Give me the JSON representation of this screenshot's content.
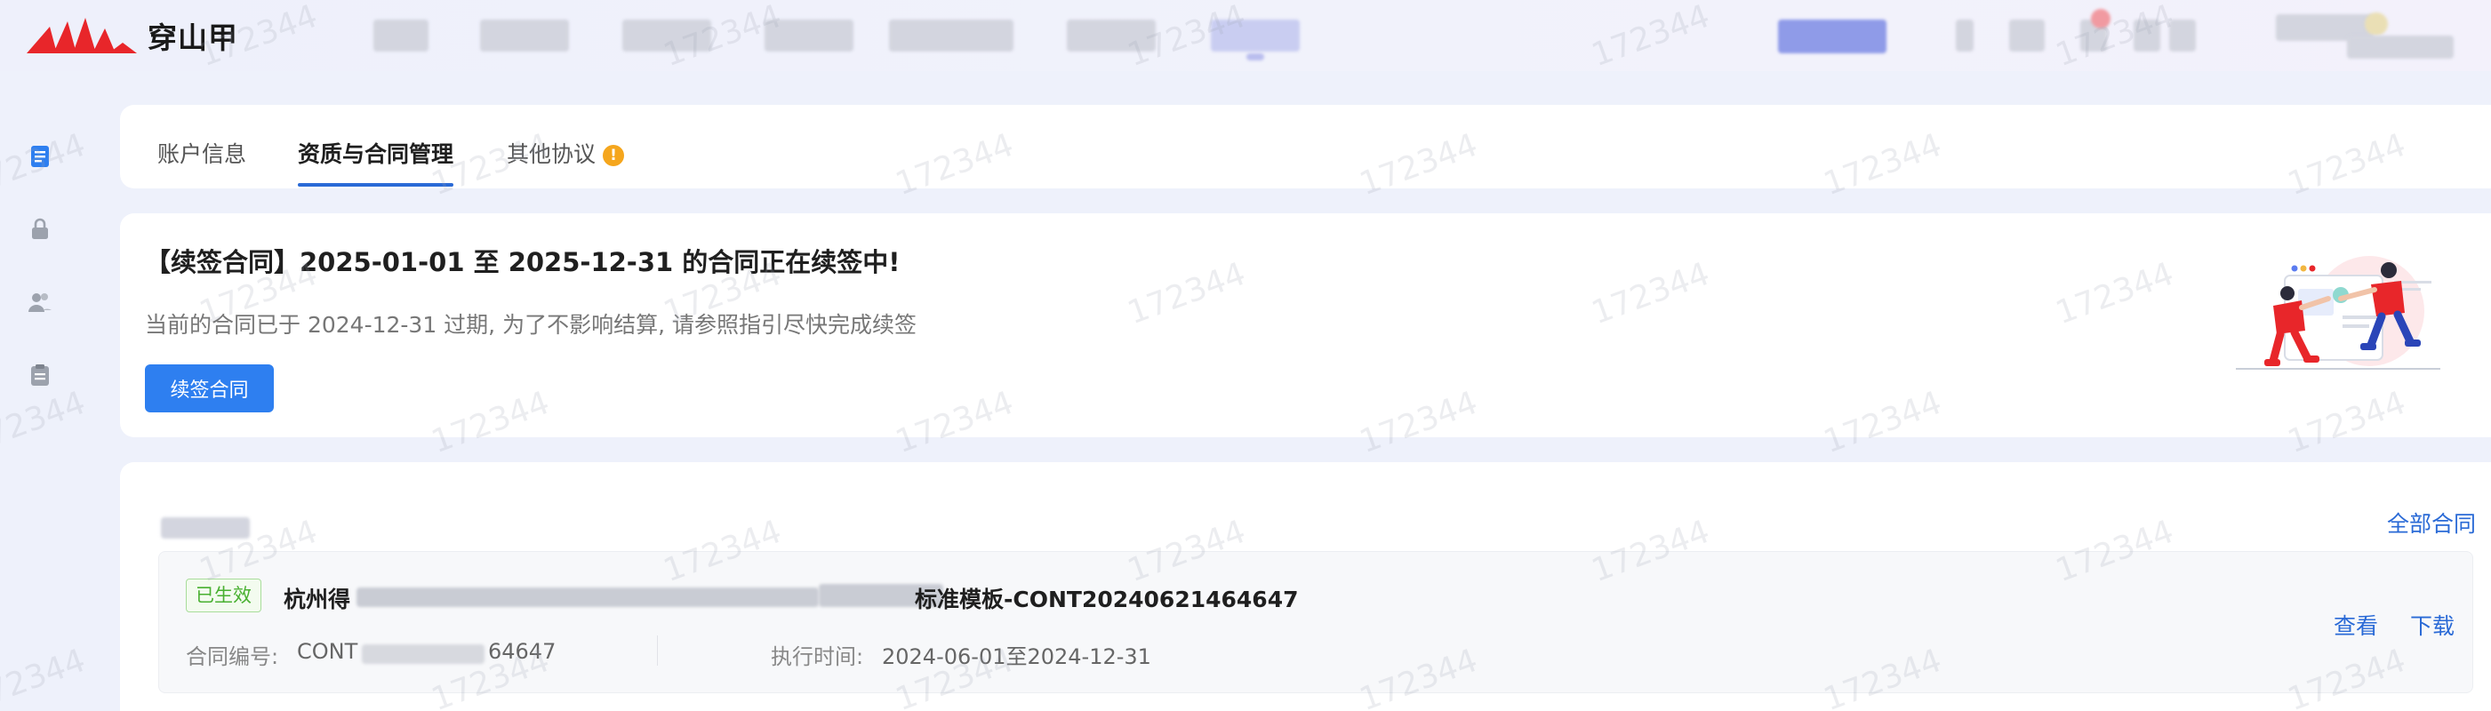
{
  "header": {
    "logo_text": "穿山甲",
    "brand_color": "#e8262a"
  },
  "sidebar": {
    "items": [
      {
        "icon": "document-icon",
        "active": true
      },
      {
        "icon": "lock-icon",
        "active": false
      },
      {
        "icon": "users-icon",
        "active": false
      },
      {
        "icon": "clipboard-icon",
        "active": false
      }
    ]
  },
  "tabs": {
    "items": [
      {
        "label": "账户信息"
      },
      {
        "label": "资质与合同管理",
        "active": true
      },
      {
        "label": "其他协议",
        "badge": "!"
      }
    ]
  },
  "renew": {
    "title": "【续签合同】2025-01-01 至 2025-12-31 的合同正在续签中!",
    "description": "当前的合同已于 2024-12-31 过期, 为了不影响结算, 请参照指引尽快完成续签",
    "button_label": "续签合同"
  },
  "contracts": {
    "all_link": "全部合同",
    "items": [
      {
        "status": "已生效",
        "name_prefix": "杭州得",
        "name_suffix": "标准模板-CONT20240621464647",
        "number_label": "合同编号:",
        "number_prefix": "CONT",
        "number_suffix": "64647",
        "period_label": "执行时间:",
        "period_value": "2024-06-01至2024-12-31",
        "view_label": "查看",
        "download_label": "下载"
      }
    ]
  },
  "watermark": "172344",
  "colors": {
    "accent": "#2e7ff0",
    "link": "#2a6ad6",
    "status_green": "#48b030",
    "warning": "#f5a61d"
  }
}
